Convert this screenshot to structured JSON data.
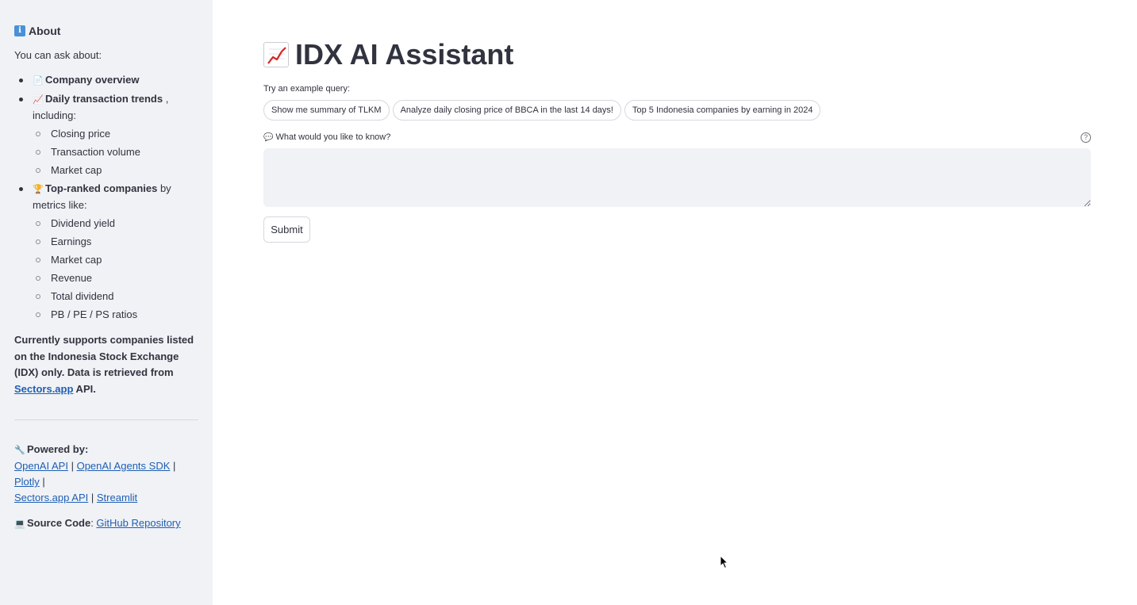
{
  "sidebar": {
    "about_title": "About",
    "intro": "You can ask about:",
    "topics": [
      {
        "icon": "page-icon",
        "bold": "Company overview",
        "rest": ""
      },
      {
        "icon": "chart-icon",
        "bold": "Daily transaction trends",
        "rest": " , including:",
        "sub": [
          "Closing price",
          "Transaction volume",
          "Market cap"
        ]
      },
      {
        "icon": "trophy-icon",
        "bold": "Top-ranked companies",
        "rest": " by metrics like:",
        "sub": [
          "Dividend yield",
          "Earnings",
          "Market cap",
          "Revenue",
          "Total dividend",
          "PB / PE / PS ratios"
        ]
      }
    ],
    "note_part1": "Currently supports companies listed on the Indonesia Stock Exchange (IDX) only. Data is retrieved from ",
    "note_link": "Sectors.app",
    "note_part2": " API.",
    "powered_by": "Powered by:",
    "powered_links": [
      "OpenAI API",
      "OpenAI Agents SDK",
      "Plotly",
      "Sectors.app API",
      "Streamlit"
    ],
    "source_label": "Source Code",
    "source_link": "GitHub Repository"
  },
  "main": {
    "title": "IDX AI Assistant",
    "example_label": "Try an example query:",
    "examples": [
      "Show me summary of TLKM",
      "Analyze daily closing price of BBCA in the last 14 days!",
      "Top 5 Indonesia companies by earning in 2024"
    ],
    "query_label": "What would you like to know?",
    "query_value": "",
    "submit_label": "Submit"
  }
}
